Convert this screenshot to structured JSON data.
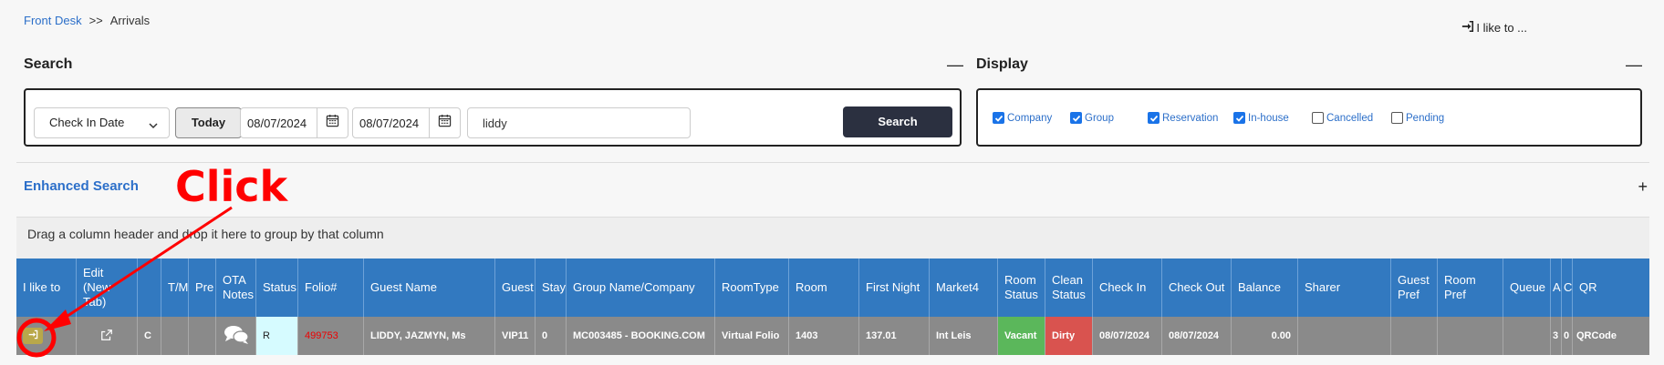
{
  "breadcrumb": {
    "root": "Front Desk",
    "separator": ">>",
    "current": "Arrivals"
  },
  "header": {
    "ilike_label": "I like to ..."
  },
  "search": {
    "title": "Search",
    "collapse_symbol": "—",
    "date_type": "Check In Date",
    "today_label": "Today",
    "date_from": "08/07/2024",
    "date_to": "08/07/2024",
    "query": "liddy",
    "search_label": "Search"
  },
  "display": {
    "title": "Display",
    "collapse_symbol": "—",
    "options": [
      {
        "label": "Company",
        "checked": true
      },
      {
        "label": "Group",
        "checked": true
      },
      {
        "label": "Reservation",
        "checked": true
      },
      {
        "label": "In-house",
        "checked": true
      },
      {
        "label": "Cancelled",
        "checked": false
      },
      {
        "label": "Pending",
        "checked": false
      }
    ]
  },
  "enhanced": {
    "title": "Enhanced Search",
    "expand_symbol": "+"
  },
  "grid": {
    "group_hint": "Drag a column header and drop it here to group by that column",
    "headers": [
      "I like to",
      "Edit (New Tab)",
      "",
      "T/M",
      "Pre",
      "OTA Notes",
      "Status",
      "Folio#",
      "Guest Name",
      "Guest",
      "Stay",
      "Group Name/Company",
      "RoomType",
      "Room",
      "First Night",
      "Market4",
      "Room Status",
      "Clean Status",
      "Check In",
      "Check Out",
      "Balance",
      "Sharer",
      "Guest Pref",
      "Room Pref",
      "Queue",
      "A",
      "C",
      "QR"
    ],
    "row": {
      "c_col": "C",
      "status": "R",
      "folio": "499753",
      "guest_name": "LIDDY, JAZMYN, Ms",
      "guest": "VIP11",
      "stay": "0",
      "group_company": "MC003485 - BOOKING.COM",
      "room_type": "Virtual Folio",
      "room": "1403",
      "first_night": "137.01",
      "market": "Int Leis",
      "room_status": "Vacant",
      "clean_status": "Dirty",
      "check_in": "08/07/2024",
      "check_out": "08/07/2024",
      "balance": "0.00",
      "a_col": "3",
      "c2_col": "0",
      "qr": "QRCode"
    }
  },
  "annotation": {
    "text": "Click",
    "color": "#ff0000"
  },
  "colors": {
    "header_blue": "#3279c0",
    "row_gray": "#8a8a8a",
    "vacant": "#5bb75b",
    "dirty": "#d9534f",
    "link": "#2c6fc9",
    "search_btn": "#2b3040"
  }
}
